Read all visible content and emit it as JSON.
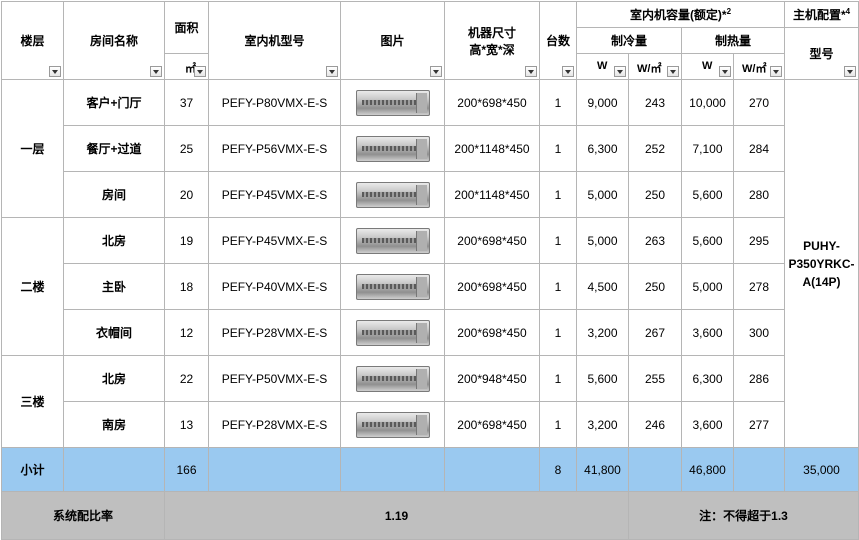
{
  "headers": {
    "floor": "楼层",
    "room_name": "房间名称",
    "area": "面积",
    "area_unit": "㎡",
    "indoor_model": "室内机型号",
    "picture": "图片",
    "dimension_line1": "机器尺寸",
    "dimension_line2": "高*宽*深",
    "count": "台数",
    "capacity": "室内机容量(额定)*",
    "capacity_sup": "2",
    "cooling": "制冷量",
    "heating": "制热量",
    "w_label": "W",
    "wm2_label": "W/㎡",
    "main_config": "主机配置*",
    "main_config_sup": "4",
    "model": "型号"
  },
  "floors": [
    "一层",
    "二楼",
    "三楼"
  ],
  "rows": [
    {
      "room": "客户+门厅",
      "area": "37",
      "model": "PEFY-P80VMX-E-S",
      "dim": "200*698*450",
      "count": "1",
      "cool_w": "9,000",
      "cool_wm2": "243",
      "heat_w": "10,000",
      "heat_wm2": "270"
    },
    {
      "room": "餐厅+过道",
      "area": "25",
      "model": "PEFY-P56VMX-E-S",
      "dim": "200*1148*450",
      "count": "1",
      "cool_w": "6,300",
      "cool_wm2": "252",
      "heat_w": "7,100",
      "heat_wm2": "284"
    },
    {
      "room": "房间",
      "area": "20",
      "model": "PEFY-P45VMX-E-S",
      "dim": "200*1148*450",
      "count": "1",
      "cool_w": "5,000",
      "cool_wm2": "250",
      "heat_w": "5,600",
      "heat_wm2": "280"
    },
    {
      "room": "北房",
      "area": "19",
      "model": "PEFY-P45VMX-E-S",
      "dim": "200*698*450",
      "count": "1",
      "cool_w": "5,000",
      "cool_wm2": "263",
      "heat_w": "5,600",
      "heat_wm2": "295"
    },
    {
      "room": "主卧",
      "area": "18",
      "model": "PEFY-P40VMX-E-S",
      "dim": "200*698*450",
      "count": "1",
      "cool_w": "4,500",
      "cool_wm2": "250",
      "heat_w": "5,000",
      "heat_wm2": "278"
    },
    {
      "room": "衣帽间",
      "area": "12",
      "model": "PEFY-P28VMX-E-S",
      "dim": "200*698*450",
      "count": "1",
      "cool_w": "3,200",
      "cool_wm2": "267",
      "heat_w": "3,600",
      "heat_wm2": "300"
    },
    {
      "room": "北房",
      "area": "22",
      "model": "PEFY-P50VMX-E-S",
      "dim": "200*948*450",
      "count": "1",
      "cool_w": "5,600",
      "cool_wm2": "255",
      "heat_w": "6,300",
      "heat_wm2": "286"
    },
    {
      "room": "南房",
      "area": "13",
      "model": "PEFY-P28VMX-E-S",
      "dim": "200*698*450",
      "count": "1",
      "cool_w": "3,200",
      "cool_wm2": "246",
      "heat_w": "3,600",
      "heat_wm2": "277"
    }
  ],
  "main_unit": {
    "line1": "PUHY-",
    "line2": "P350YRKC-",
    "line3": "A(14P)"
  },
  "subtotal": {
    "label": "小计",
    "area": "166",
    "count": "8",
    "cool_w": "41,800",
    "heat_w": "46,800",
    "main": "35,000"
  },
  "system": {
    "label": "系统配比率",
    "ratio": "1.19",
    "note": "注：不得超于1.3"
  },
  "colors": {
    "subtotal_bg": "#9ac9f0",
    "system_bg": "#bfbfbf",
    "grid": "#b5b5b5",
    "cell_marker": "#2e8b3a"
  }
}
